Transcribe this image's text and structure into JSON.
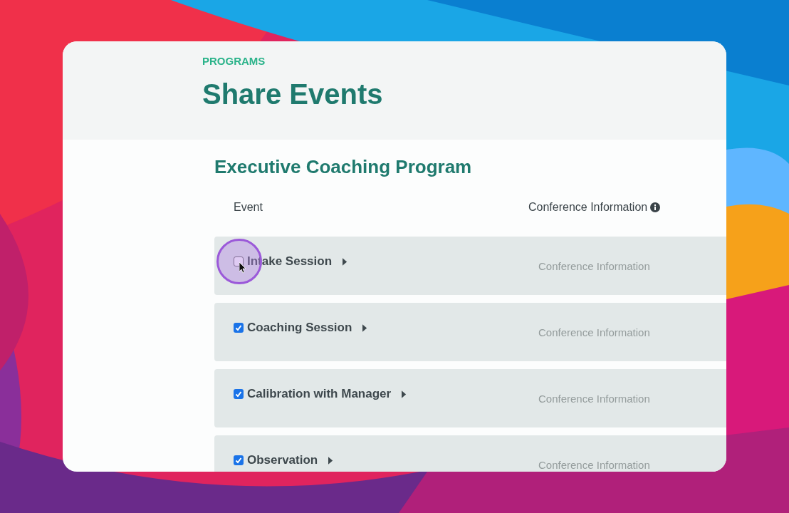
{
  "header": {
    "eyebrow": "PROGRAMS",
    "title": "Share Events"
  },
  "program": {
    "title": "Executive Coaching Program"
  },
  "table": {
    "columns": [
      {
        "label": "Event",
        "kind": "plain"
      },
      {
        "label": "Conference Information",
        "kind": "info"
      }
    ],
    "rows": [
      {
        "event": "Intake Session",
        "checked": false,
        "conference": "Conference Information"
      },
      {
        "event": "Coaching Session",
        "checked": true,
        "conference": "Conference Information"
      },
      {
        "event": "Calibration with Manager",
        "checked": true,
        "conference": "Conference Information"
      },
      {
        "event": "Observation",
        "checked": true,
        "conference": "Conference Information"
      }
    ]
  }
}
